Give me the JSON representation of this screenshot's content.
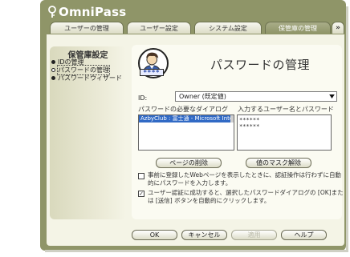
{
  "app": {
    "title": "OmniPass"
  },
  "tabs": [
    {
      "label": "ユーザーの管理"
    },
    {
      "label": "ユーザー設定"
    },
    {
      "label": "システム設定"
    },
    {
      "label": "保管庫の管理"
    }
  ],
  "tabs_more": "»",
  "sidebar": {
    "title": "保管庫設定",
    "items": [
      {
        "label": "IDの管理"
      },
      {
        "label": "パスワードの管理"
      },
      {
        "label": "パスワードウィザード"
      }
    ]
  },
  "panel": {
    "title": "パスワードの管理",
    "avatar_badge": "****",
    "id_label": "ID:",
    "id_value": "Owner (既定値)",
    "col_dialog_label": "パスワードの必要なダイアログ",
    "col_creds_label": "入力するユーザー名とパスワード",
    "dialog_items": [
      "AzbyClub : 富士通 - Microsoft Inte"
    ],
    "credentials": [
      "******",
      "******"
    ],
    "delete_page_button": "ページの削除",
    "unmask_button": "値のマスク解除",
    "option1_text": "事前に登録したWebページを表示したときに、認証操作は行わずに自動的にパスワードを入力します。",
    "option1_checked": false,
    "option2_text": "ユーザー認証に成功すると、選択したパスワードダイアログの [OK]または [送信] ボタンを自動的にクリックします。",
    "option2_checked": true
  },
  "footer": {
    "ok": "OK",
    "cancel": "キャンセル",
    "apply": "適用",
    "help": "ヘルプ"
  },
  "colors": {
    "frame": "#8f9568",
    "content": "#f4f4e6",
    "selection": "#316ac5"
  },
  "icons": {
    "logo": "fingerprint-key-icon",
    "avatar": "user-avatar-icon",
    "dropdown": "chevron-down-icon"
  }
}
